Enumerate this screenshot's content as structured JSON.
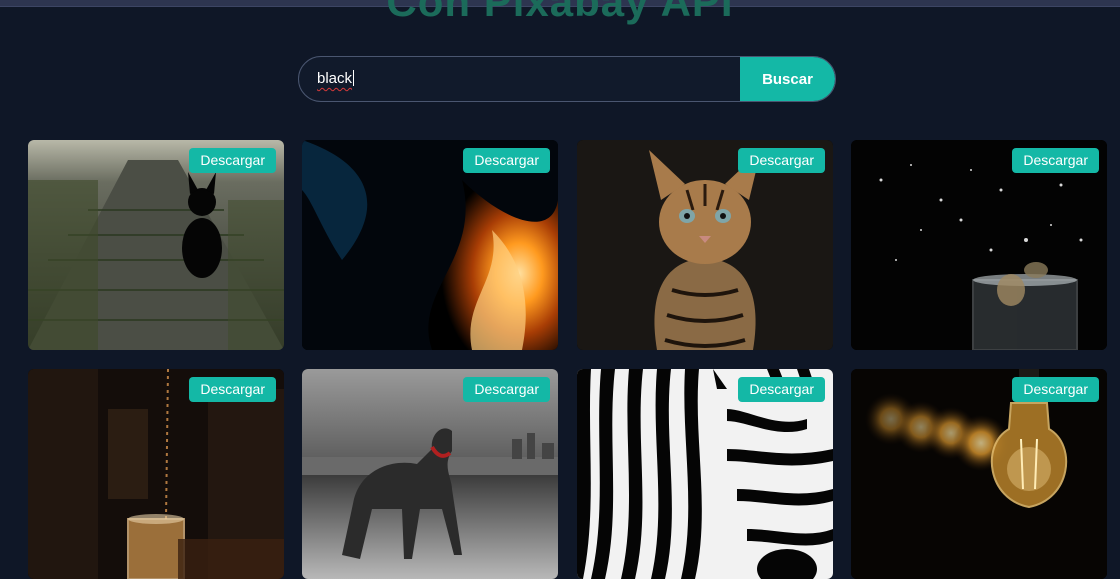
{
  "header": {
    "title": "Con Pixabay API"
  },
  "search": {
    "value": "black",
    "button_label": "Buscar"
  },
  "gallery": {
    "items": [
      {
        "subject": "black-kitten-on-path",
        "download_label": "Descargar"
      },
      {
        "subject": "flame",
        "download_label": "Descargar"
      },
      {
        "subject": "bengal-cat",
        "download_label": "Descargar"
      },
      {
        "subject": "water-splash-glass",
        "download_label": "Descargar"
      },
      {
        "subject": "drink-pour",
        "download_label": "Descargar"
      },
      {
        "subject": "dog-on-beach",
        "download_label": "Descargar"
      },
      {
        "subject": "zebra",
        "download_label": "Descargar"
      },
      {
        "subject": "light-bulb",
        "download_label": "Descargar"
      }
    ]
  },
  "colors": {
    "background": "#0f1727",
    "accent": "#14b8a6",
    "title": "#1b6b5a"
  }
}
